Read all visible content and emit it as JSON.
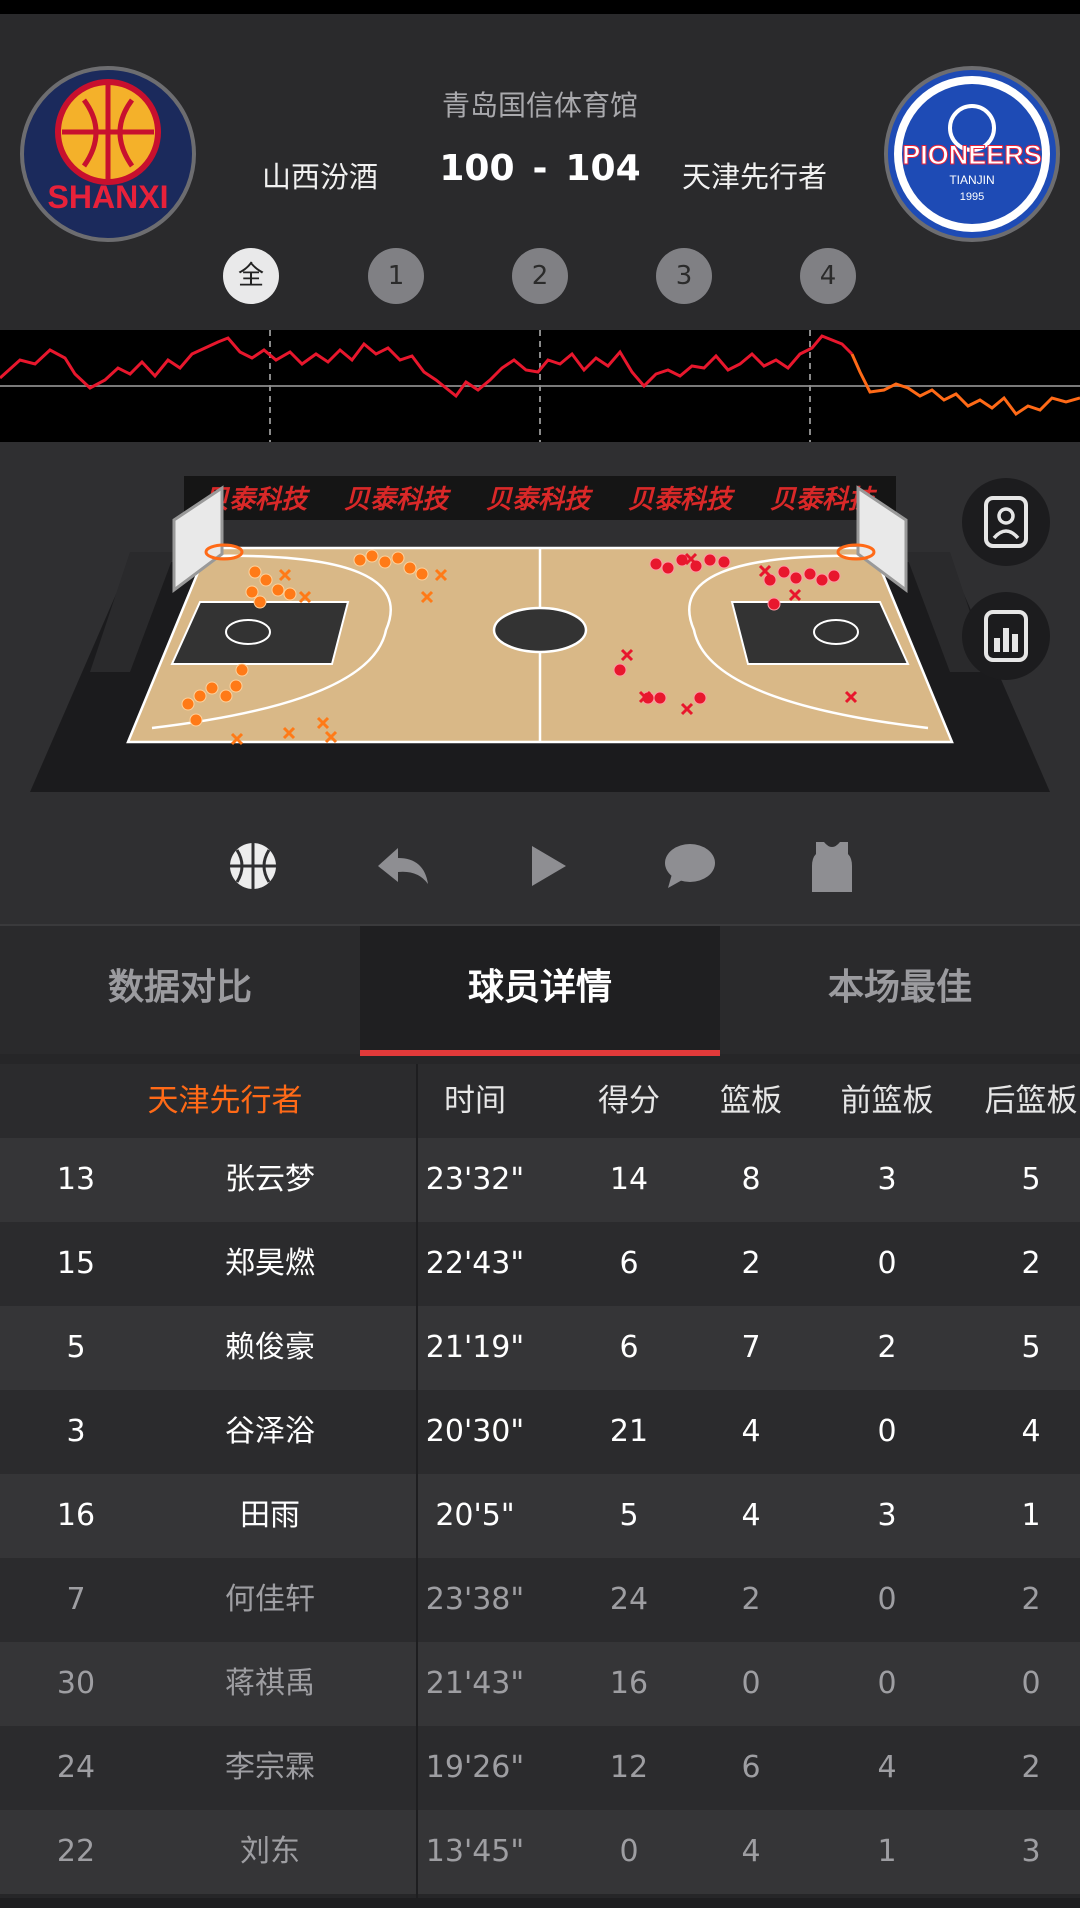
{
  "game": {
    "venue": "青岛国信体育馆",
    "home_team": "山西汾酒",
    "away_team": "天津先行者",
    "home_score": "100",
    "score_sep": "-",
    "away_score": "104",
    "home_logo_text": "SHANXI",
    "away_logo_text": "PIONEERS",
    "away_logo_sub": "TIANJIN",
    "away_logo_year": "1995"
  },
  "periods": [
    "全",
    "1",
    "2",
    "3",
    "4"
  ],
  "colors": {
    "home": "#ff6a17",
    "away": "#e8172d",
    "tab_accent": "#e23a3a"
  },
  "court": {
    "ad_text": "贝泰科技"
  },
  "toolbar": {
    "icons": [
      "basketball-icon",
      "replay-icon",
      "play-icon",
      "comment-icon",
      "jersey-icon"
    ]
  },
  "side_buttons": [
    "player-card-icon",
    "stats-report-icon"
  ],
  "tabs": [
    {
      "label": "数据对比",
      "active": false
    },
    {
      "label": "球员详情",
      "active": true
    },
    {
      "label": "本场最佳",
      "active": false
    }
  ],
  "table": {
    "team_header": "天津先行者",
    "columns": [
      "时间",
      "得分",
      "篮板",
      "前篮板",
      "后篮板"
    ],
    "rows": [
      {
        "number": "13",
        "name": "张云梦",
        "time": "23'32\"",
        "pts": "14",
        "reb": "8",
        "oreb": "3",
        "dreb": "5",
        "starter": true
      },
      {
        "number": "15",
        "name": "郑昊燃",
        "time": "22'43\"",
        "pts": "6",
        "reb": "2",
        "oreb": "0",
        "dreb": "2",
        "starter": true
      },
      {
        "number": "5",
        "name": "赖俊豪",
        "time": "21'19\"",
        "pts": "6",
        "reb": "7",
        "oreb": "2",
        "dreb": "5",
        "starter": true
      },
      {
        "number": "3",
        "name": "谷泽浴",
        "time": "20'30\"",
        "pts": "21",
        "reb": "4",
        "oreb": "0",
        "dreb": "4",
        "starter": true
      },
      {
        "number": "16",
        "name": "田雨",
        "time": "20'5\"",
        "pts": "5",
        "reb": "4",
        "oreb": "3",
        "dreb": "1",
        "starter": true
      },
      {
        "number": "7",
        "name": "何佳轩",
        "time": "23'38\"",
        "pts": "24",
        "reb": "2",
        "oreb": "0",
        "dreb": "2",
        "starter": false
      },
      {
        "number": "30",
        "name": "蒋祺禹",
        "time": "21'43\"",
        "pts": "16",
        "reb": "0",
        "oreb": "0",
        "dreb": "0",
        "starter": false
      },
      {
        "number": "24",
        "name": "李宗霖",
        "time": "19'26\"",
        "pts": "12",
        "reb": "6",
        "oreb": "4",
        "dreb": "2",
        "starter": false
      },
      {
        "number": "22",
        "name": "刘东",
        "time": "13'45\"",
        "pts": "0",
        "reb": "4",
        "oreb": "1",
        "dreb": "3",
        "starter": false
      }
    ]
  }
}
